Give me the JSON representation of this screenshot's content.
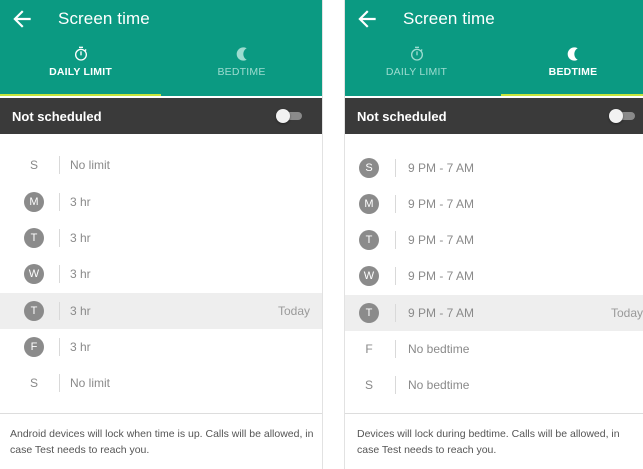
{
  "left": {
    "title": "Screen time",
    "tabs": [
      {
        "label": "DAILY LIMIT",
        "icon": "stopwatch-icon",
        "active": true
      },
      {
        "label": "BEDTIME",
        "icon": "moon-icon",
        "active": false
      }
    ],
    "schedule": {
      "label": "Not scheduled",
      "enabled": false
    },
    "days": [
      {
        "letter": "S",
        "value": "No limit",
        "circle": false,
        "today": ""
      },
      {
        "letter": "M",
        "value": "3 hr",
        "circle": true,
        "today": ""
      },
      {
        "letter": "T",
        "value": "3 hr",
        "circle": true,
        "today": ""
      },
      {
        "letter": "W",
        "value": "3 hr",
        "circle": true,
        "today": ""
      },
      {
        "letter": "T",
        "value": "3 hr",
        "circle": true,
        "today": "Today"
      },
      {
        "letter": "F",
        "value": "3 hr",
        "circle": true,
        "today": ""
      },
      {
        "letter": "S",
        "value": "No limit",
        "circle": false,
        "today": ""
      }
    ],
    "footer": "Android devices will lock when time is up. Calls will be allowed, in case Test needs to reach you."
  },
  "right": {
    "title": "Screen time",
    "tabs": [
      {
        "label": "DAILY LIMIT",
        "icon": "stopwatch-icon",
        "active": false
      },
      {
        "label": "BEDTIME",
        "icon": "moon-icon",
        "active": true
      }
    ],
    "schedule": {
      "label": "Not scheduled",
      "enabled": false
    },
    "days": [
      {
        "letter": "S",
        "value": "9 PM - 7 AM",
        "circle": true,
        "today": ""
      },
      {
        "letter": "M",
        "value": "9 PM - 7 AM",
        "circle": true,
        "today": ""
      },
      {
        "letter": "T",
        "value": "9 PM - 7 AM",
        "circle": true,
        "today": ""
      },
      {
        "letter": "W",
        "value": "9 PM - 7 AM",
        "circle": true,
        "today": ""
      },
      {
        "letter": "T",
        "value": "9 PM - 7 AM",
        "circle": true,
        "today": "Today"
      },
      {
        "letter": "F",
        "value": "No bedtime",
        "circle": false,
        "today": ""
      },
      {
        "letter": "S",
        "value": "No bedtime",
        "circle": false,
        "today": ""
      }
    ],
    "footer": "Devices will lock during bedtime. Calls will be allowed, in case Test needs to reach you."
  },
  "colors": {
    "header_teal": "#0b9a82",
    "tab_indicator": "#c7e43b",
    "schedule_bar": "#3a3a3a",
    "today_row": "#eeeeee",
    "day_circle": "#8b8b8b"
  }
}
